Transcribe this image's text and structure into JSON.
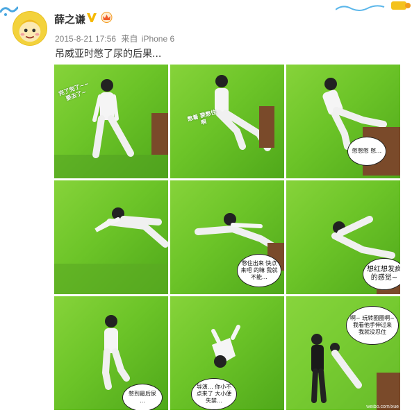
{
  "post": {
    "username": "薛之谦",
    "date": "2015-8-21 17:56",
    "source_prefix": "来自",
    "source_device": "iPhone 6",
    "text": "吊威亚时憋了尿的后果..."
  },
  "icons": {
    "verified": "verified-v-icon",
    "vip": "vip-badge-icon"
  },
  "colors": {
    "greenscreen": "#6cc428",
    "verified": "#f5b800",
    "text": "#333333",
    "meta": "#808080"
  },
  "photos": [
    {
      "bubble": "完了完了~~要去了~"
    },
    {
      "bubble": "憋着 要憋住啊"
    },
    {
      "bubble": "憋憋憋 憋…"
    },
    {
      "bubble": ""
    },
    {
      "bubble": "憋住出来 快点来吧 的嘛 我就不能…"
    },
    {
      "bubble": "想红想发疯 的感觉~"
    },
    {
      "bubble": "憋到最后尿 …"
    },
    {
      "bubble": "导演… 你小不点来了 大小便失禁…"
    },
    {
      "bubble": "啊~ 玩转圈圈啊~ 我看他手伸过来 我就没忍住"
    }
  ],
  "watermark": "weibo.com/xue"
}
